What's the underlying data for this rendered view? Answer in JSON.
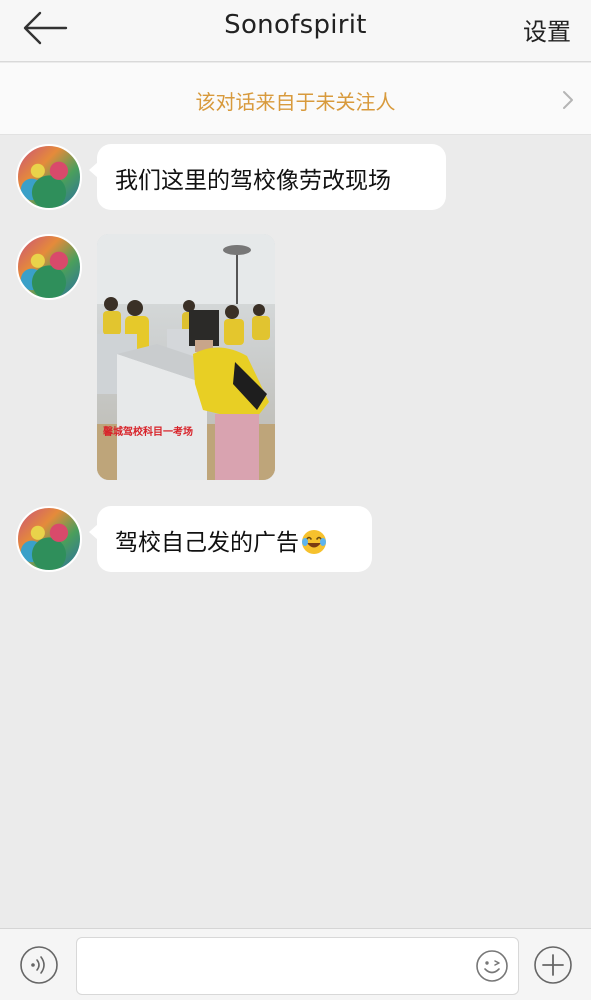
{
  "navbar": {
    "title": "Sonofspirit",
    "settings_label": "设置",
    "back_icon": "arrow-left-icon"
  },
  "notice": {
    "text": "该对话来自于未关注人",
    "icon": "chevron-right-icon",
    "color": "#d89a3c"
  },
  "messages": [
    {
      "type": "text",
      "text": "我们这里的驾校像劳改现场"
    },
    {
      "type": "image",
      "caption": "馨城驾校科目一考场"
    },
    {
      "type": "text",
      "text": "驾校自己发的广告",
      "emoji": "crying-laughing-emoji"
    }
  ],
  "input_bar": {
    "value": "",
    "placeholder": "",
    "voice_icon": "voice-icon",
    "emoji_icon": "smiley-icon",
    "plus_icon": "plus-icon"
  },
  "colors": {
    "chat_background": "#ebebeb",
    "bubble": "#ffffff"
  }
}
